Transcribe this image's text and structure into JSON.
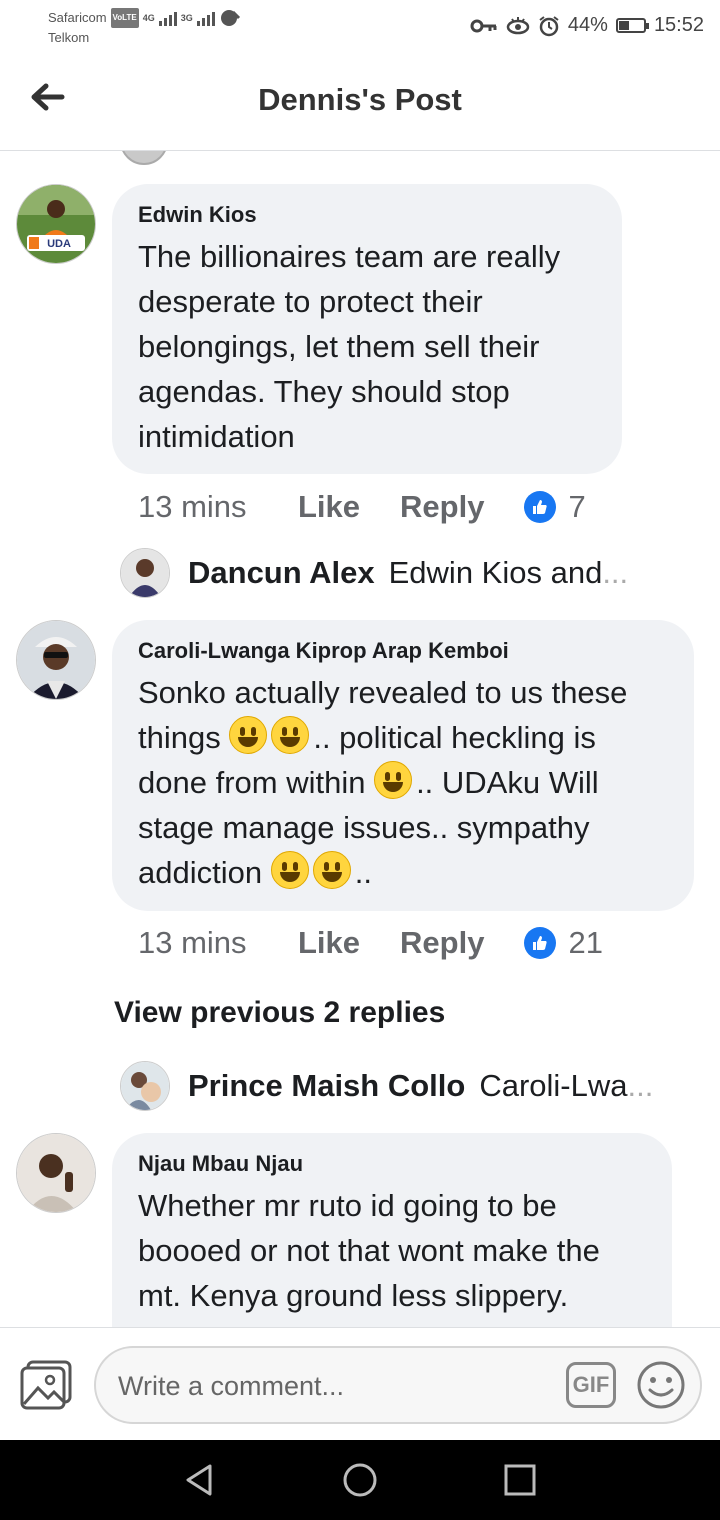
{
  "status_bar": {
    "carrier1": "Safaricom",
    "carrier2": "Telkom",
    "volte": "VoLTE",
    "net1": "4G",
    "net2": "3G",
    "battery": "44%",
    "battery_level": 0.44,
    "time": "15:52"
  },
  "header": {
    "title": "Dennis's Post"
  },
  "comments": [
    {
      "author": "Edwin Kios",
      "text": "The billionaires team are really desperate to protect their belongings, let them sell their agendas. They should stop intimidation",
      "avatar_badge": "UDA",
      "time": "13 mins",
      "like_label": "Like",
      "reply_label": "Reply",
      "reactions": "7",
      "reply_preview": {
        "author": "Dancun Alex",
        "text": "Edwin Kios and",
        "ellipsis": "..."
      }
    },
    {
      "author": "Caroli-Lwanga Kiprop Arap Kemboi",
      "line1": "Sonko actually revealed to us these",
      "line2a": "things ",
      "line2b": ".. political heckling is",
      "line3a": "done from within ",
      "line3b": ".. UDAku Will",
      "line4": "stage manage issues.. sympathy",
      "line5a": "addiction ",
      "line5b": "..",
      "time": "13 mins",
      "like_label": "Like",
      "reply_label": "Reply",
      "reactions": "21",
      "view_previous": "View previous 2 replies",
      "reply_preview": {
        "author": "Prince Maish Collo",
        "text": "Caroli-Lwa",
        "ellipsis": "..."
      }
    },
    {
      "author": "Njau Mbau Njau",
      "text": "Whether mr ruto id going to be boooed or not that wont make the mt. Kenya ground less slippery."
    }
  ],
  "composer": {
    "placeholder": "Write a comment...",
    "gif_label": "GIF"
  }
}
